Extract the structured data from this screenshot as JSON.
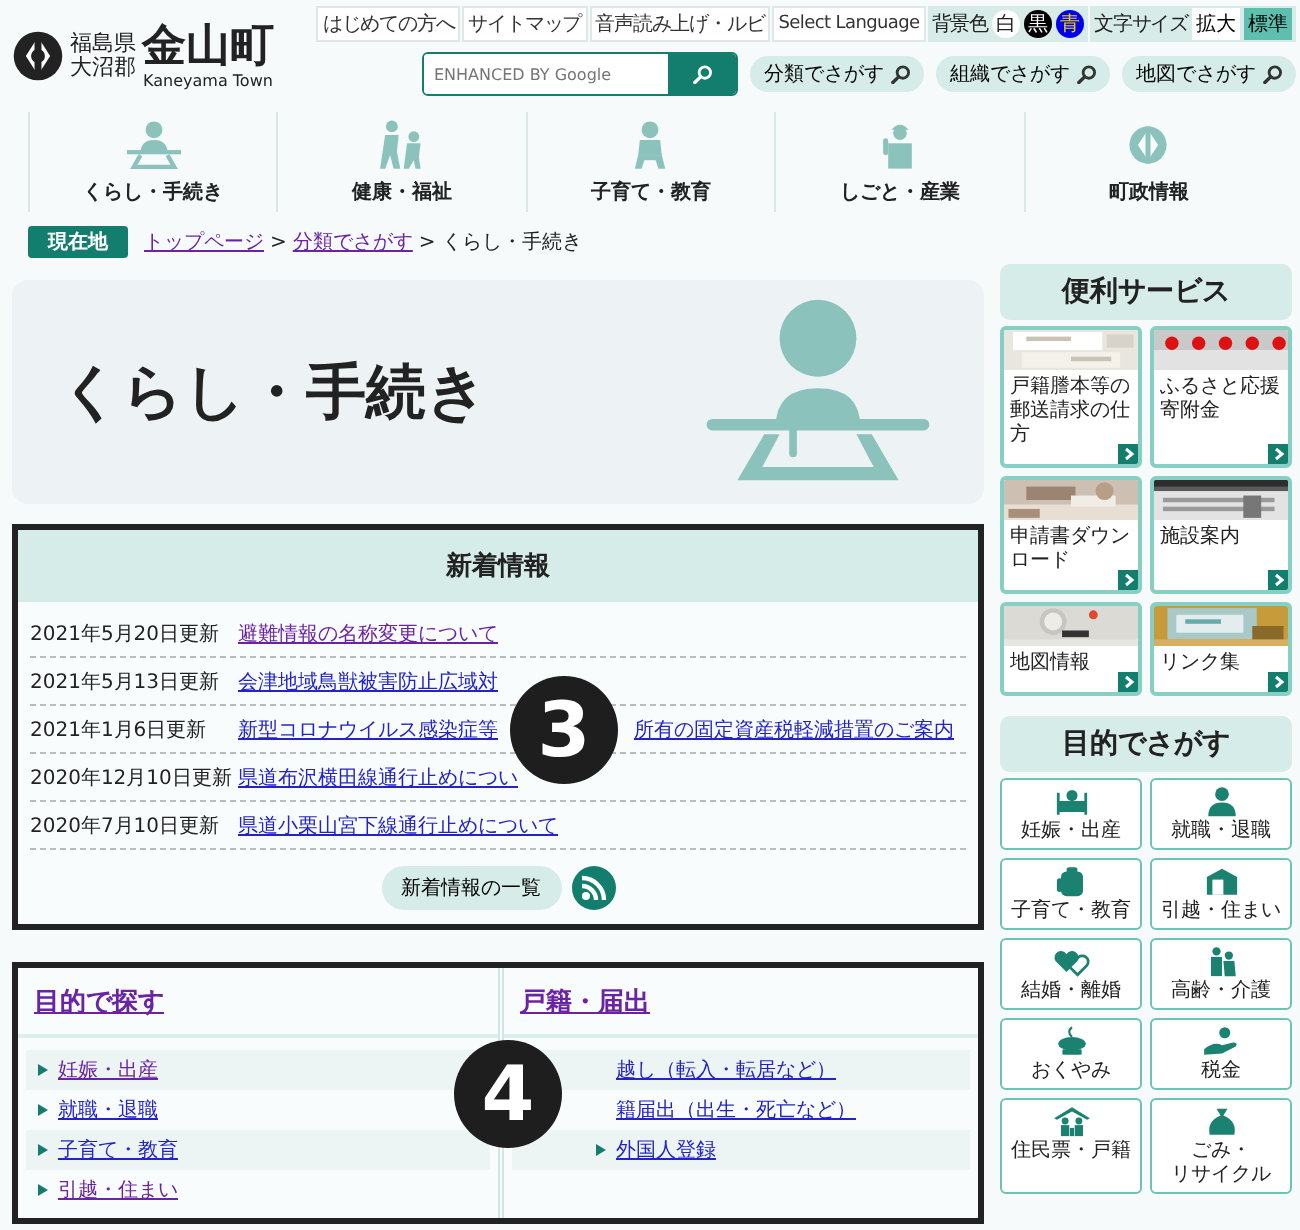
{
  "header": {
    "prefecture": "福島県",
    "district": "大沼郡",
    "town": "金山町",
    "town_en": "Kaneyama Town",
    "utility_links": [
      "はじめての方へ",
      "サイトマップ",
      "音声読み上げ・ルビ",
      "Select Language"
    ],
    "background_label": "背景色",
    "background_options": [
      {
        "label": "白",
        "color": "#ffffff"
      },
      {
        "label": "黒",
        "color": "#000000"
      },
      {
        "label": "青",
        "color": "#0000ee"
      }
    ],
    "font_size_label": "文字サイズ",
    "font_sizes": [
      {
        "label": "拡大",
        "selected": false
      },
      {
        "label": "標準",
        "selected": true
      }
    ],
    "search": {
      "placeholder": "ENHANCED BY Google"
    },
    "search_links": [
      "分類でさがす",
      "組織でさがす",
      "地図でさがす"
    ]
  },
  "nav": [
    "くらし・手続き",
    "健康・福祉",
    "子育て・教育",
    "しごと・産業",
    "町政情報"
  ],
  "breadcrumb": {
    "label": "現在地",
    "items": [
      {
        "text": "トップページ",
        "kind": "link"
      },
      {
        "text": ">",
        "kind": "separator"
      },
      {
        "text": "分類でさがす",
        "kind": "link"
      },
      {
        "text": ">",
        "kind": "separator"
      },
      {
        "text": "くらし・手続き",
        "kind": "current"
      }
    ]
  },
  "hero": {
    "title": "くらし・手続き"
  },
  "news": {
    "title": "新着情報",
    "items": [
      {
        "date": "2021年5月20日更新",
        "title": "避難情報の名称変更について",
        "visited": true
      },
      {
        "date": "2021年5月13日更新",
        "title": "会津地域鳥獣被害防止広域対",
        "visited": false
      },
      {
        "date": "2021年1月6日更新",
        "title": "新型コロナウイルス感染症等",
        "title_after_marker": "所有の固定資産税軽減措置のご案内",
        "visited": false
      },
      {
        "date": "2020年12月10日更新",
        "title": "県道布沢横田線通行止めについ",
        "visited": false
      },
      {
        "date": "2020年7月10日更新",
        "title": "県道小栗山宮下線通行止めについて",
        "visited": false
      }
    ],
    "more": "新着情報の一覧"
  },
  "categories": [
    {
      "title": "目的で探す",
      "visited": true,
      "links": [
        {
          "text": "妊娠・出産",
          "visited": true,
          "bullet": true
        },
        {
          "text": "就職・退職",
          "visited": false,
          "bullet": true
        },
        {
          "text": "子育て・教育",
          "visited": false,
          "bullet": true
        },
        {
          "text": "引越・住まい",
          "visited": true,
          "bullet": true
        }
      ]
    },
    {
      "title": "戸籍・届出",
      "visited": true,
      "links": [
        {
          "text": "越し（転入・転居など）",
          "visited": false,
          "bullet": false
        },
        {
          "text": "籍届出（出生・死亡など）",
          "visited": false,
          "bullet": false
        },
        {
          "text": "外国人登録",
          "visited": false,
          "bullet": true
        }
      ]
    }
  ],
  "services": {
    "title": "便利サービス",
    "items": [
      "戸籍謄本等の郵送請求の仕方",
      "ふるさと応援寄附金",
      "申請書ダウンロード",
      "施設案内",
      "地図情報",
      "リンク集"
    ]
  },
  "purposes": {
    "title": "目的でさがす",
    "items": [
      "妊娠・出産",
      "就職・退職",
      "子育て・教育",
      "引越・住まい",
      "結婚・離婚",
      "高齢・介護",
      "おくやみ",
      "税金",
      "住民票・戸籍",
      [
        "ごみ・",
        "リサイクル"
      ]
    ]
  },
  "markers": [
    "3",
    "4"
  ]
}
